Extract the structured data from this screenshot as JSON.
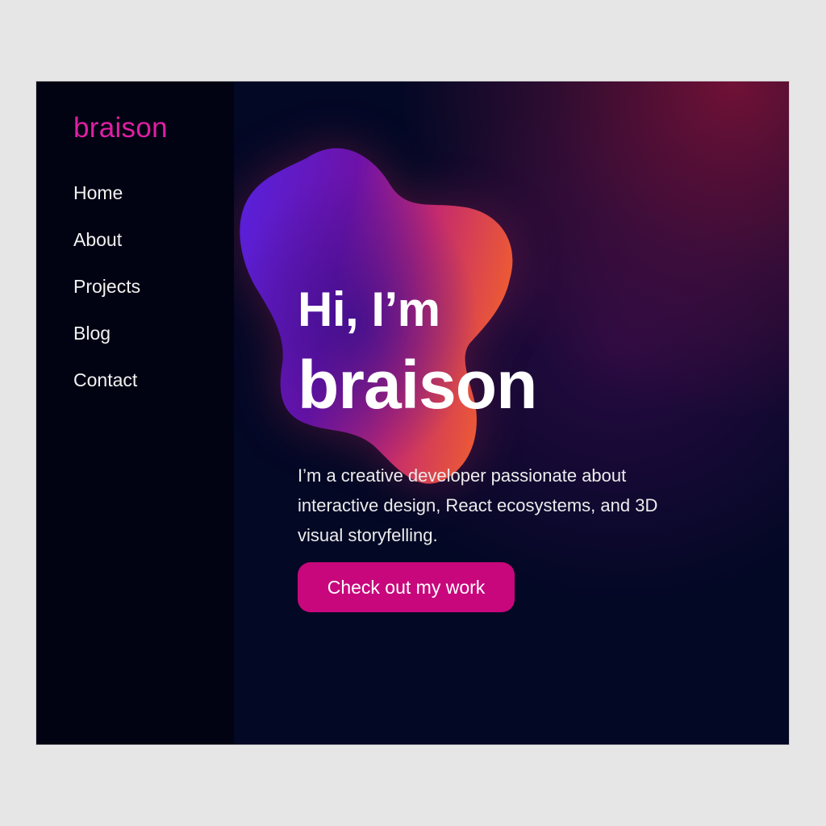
{
  "sidebar": {
    "brand": "braison",
    "nav": [
      {
        "label": "Home"
      },
      {
        "label": "About"
      },
      {
        "label": "Projects"
      },
      {
        "label": "Blog"
      },
      {
        "label": "Contact"
      }
    ]
  },
  "hero": {
    "greeting": "Hi, I’m",
    "name": "braison",
    "description": "I’m a creative developer passionate about interactive design, React ecosystems, and 3D visual storyfelling.",
    "cta_label": "Check out my work"
  },
  "colors": {
    "brand": "#e01fa3",
    "cta": "#c8077c",
    "sidebar_bg": "#010313",
    "main_bg": "#030825"
  }
}
